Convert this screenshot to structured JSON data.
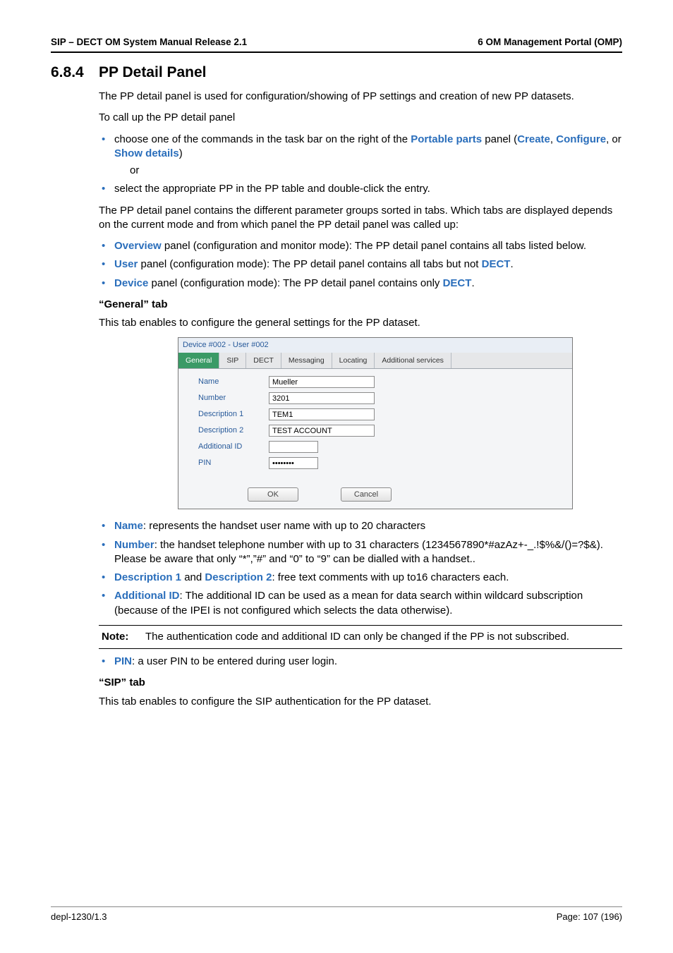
{
  "header": {
    "left": "SIP – DECT OM System Manual Release 2.1",
    "right": "6 OM Management Portal (OMP)"
  },
  "section": {
    "number": "6.8.4",
    "title": "PP Detail Panel"
  },
  "intro": {
    "p1": "The PP detail panel is used for configuration/showing of PP settings and creation of new PP datasets.",
    "p2": "To call up the PP detail panel",
    "li1_a": "choose one of the commands in the task bar on the right of the ",
    "li1_b": " panel (",
    "portable_parts": "Portable parts",
    "create": "Create",
    "sep1": ", ",
    "configure": "Configure",
    "sep2": ", or ",
    "show_details": "Show details",
    "li1_c": ")",
    "or": "or",
    "li2": "select the appropriate PP in the PP table and double-click the entry.",
    "p3": "The PP detail panel contains the different parameter groups sorted in tabs. Which tabs are displayed depends on the current mode and from which panel the PP detail panel was called up:",
    "ov_label": "Overview",
    "ov_text": " panel (configuration and monitor mode): The PP detail panel contains all tabs listed below.",
    "user_label": "User",
    "user_text_a": " panel (configuration mode): The PP detail panel contains all tabs but not ",
    "dect1": "DECT",
    "user_text_b": ".",
    "device_label": "Device",
    "device_text_a": " panel (configuration mode): The PP detail panel contains only ",
    "dect2": "DECT",
    "device_text_b": "."
  },
  "general": {
    "heading": "“General” tab",
    "p": "This tab enables to configure the general settings for the PP dataset."
  },
  "screenshot": {
    "title": "Device #002 - User #002",
    "tabs": [
      "General",
      "SIP",
      "DECT",
      "Messaging",
      "Locating",
      "Additional services"
    ],
    "fields": {
      "name": {
        "label": "Name",
        "value": "Mueller"
      },
      "number": {
        "label": "Number",
        "value": "3201"
      },
      "desc1": {
        "label": "Description 1",
        "value": "TEM1"
      },
      "desc2": {
        "label": "Description 2",
        "value": "TEST ACCOUNT"
      },
      "addid": {
        "label": "Additional ID",
        "value": ""
      },
      "pin": {
        "label": "PIN",
        "value": "••••••••"
      }
    },
    "buttons": {
      "ok": "OK",
      "cancel": "Cancel"
    }
  },
  "defs": {
    "name_l": "Name",
    "name_t": ": represents the handset user name with up to 20 characters",
    "number_l": "Number",
    "number_t": ": the handset telephone number with up to 31 characters (1234567890*#azAz+-_.!$%&/()=?$&). Please be aware that only “*”,”#” and “0” to “9” can be dialled with a handset..",
    "d1_l": "Description 1",
    "and": " and ",
    "d2_l": "Description 2",
    "d_t": ": free text comments with up to16 characters each.",
    "addid_l": "Additional ID",
    "addid_t": ": The additional ID can be used as a mean for data search within wildcard subscription (because of the IPEI is not configured which selects the data otherwise).",
    "pin_l": "PIN",
    "pin_t": ": a user PIN to be entered during user login."
  },
  "note": {
    "label": "Note:",
    "text": "The authentication code and additional ID can only be changed if the PP is not subscribed."
  },
  "sip": {
    "heading": " “SIP” tab",
    "p": "This tab enables to configure the SIP authentication for the PP dataset."
  },
  "footer": {
    "left": "depl-1230/1.3",
    "right": "Page: 107 (196)"
  }
}
